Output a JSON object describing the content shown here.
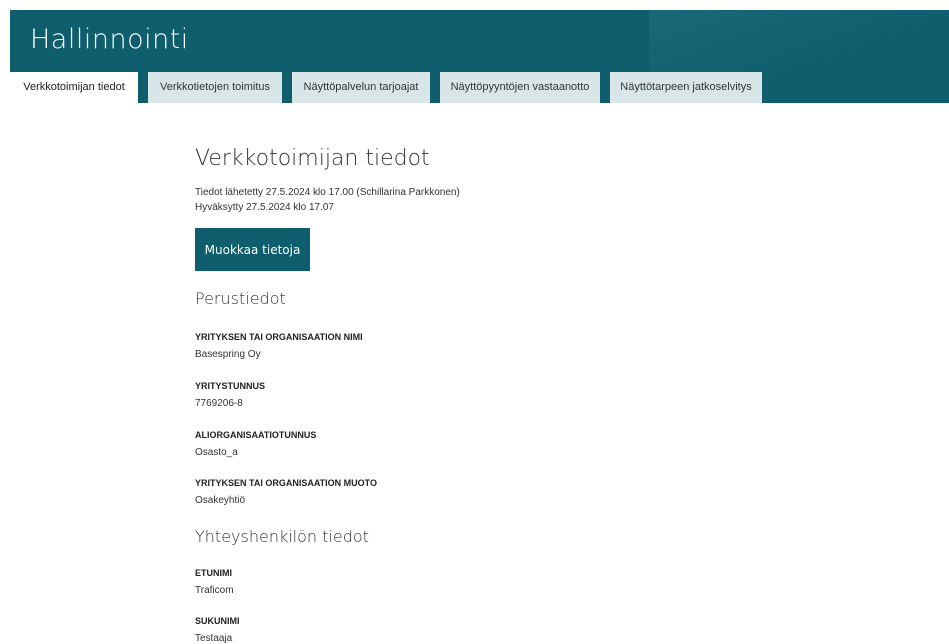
{
  "header": {
    "title": "Hallinnointi"
  },
  "tabs": [
    {
      "label": "Verkkotoimijan tiedot",
      "active": true
    },
    {
      "label": "Verkkotietojen toimitus",
      "active": false
    },
    {
      "label": "Näyttöpalvelun tarjoajat",
      "active": false
    },
    {
      "label": "Näyttöpyyntöjen vastaanotto",
      "active": false
    },
    {
      "label": "Näyttötarpeen jatkoselvitys",
      "active": false
    }
  ],
  "main": {
    "title": "Verkkotoimijan tiedot",
    "submitted": "Tiedot lähetetty 27.5.2024 klo 17.00 (Schillarina Parkkonen)",
    "approved": "Hyväksytty 27.5.2024 klo 17.07",
    "edit_button": "Muokkaa tietoja"
  },
  "basic": {
    "title": "Perustiedot",
    "fields": [
      {
        "label": "YRITYKSEN TAI ORGANISAATION NIMI",
        "value": "Basespring Oy"
      },
      {
        "label": "YRITYSTUNNUS",
        "value": "7769206-8"
      },
      {
        "label": "ALIORGANISAATIOTUNNUS",
        "value": "Osasto_a"
      },
      {
        "label": "YRITYKSEN TAI ORGANISAATION MUOTO",
        "value": "Osakeyhtiö"
      }
    ]
  },
  "contact": {
    "title": "Yhteyshenkilön tiedot",
    "fields": [
      {
        "label": "ETUNIMI",
        "value": "Traficom"
      },
      {
        "label": "SUKUNIMI",
        "value": "Testaaja"
      }
    ]
  },
  "colors": {
    "brand": "#0e5e6e",
    "tab_bg": "#d9e6e8"
  }
}
